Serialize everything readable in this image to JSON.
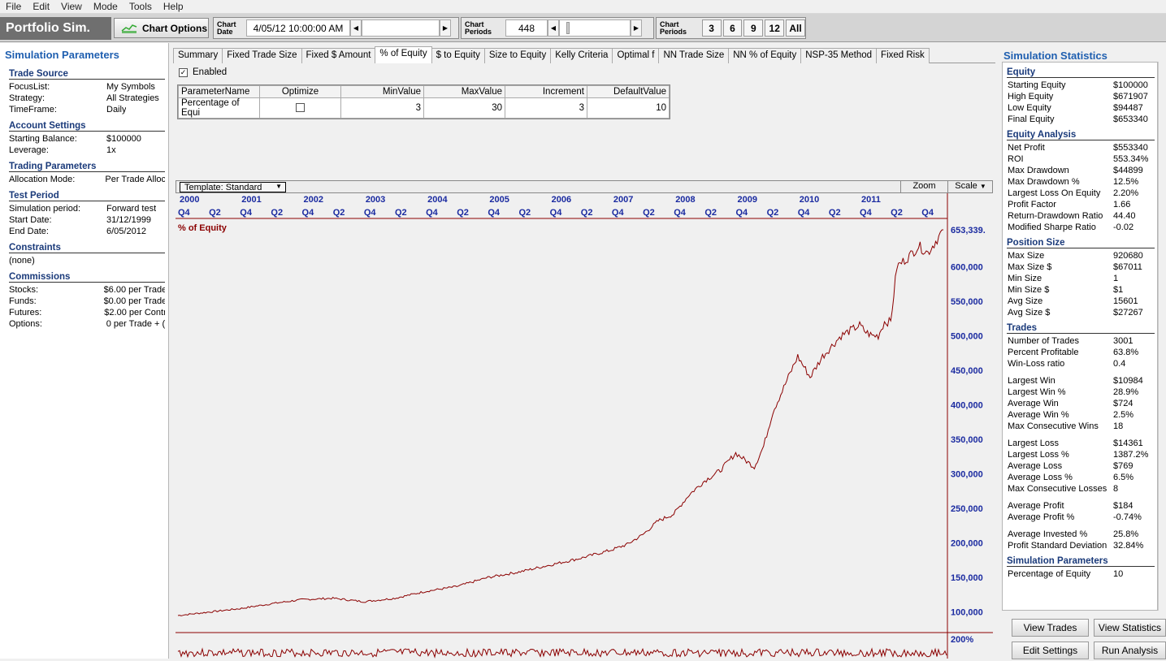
{
  "menu": [
    "File",
    "Edit",
    "View",
    "Mode",
    "Tools",
    "Help"
  ],
  "toolbar": {
    "app_name": "Portfolio Sim.",
    "chart_options_label": "Chart Options",
    "chart_date_label_1": "Chart",
    "chart_date_label_2": "Date",
    "chart_date_value": "4/05/12 10:00:00 AM",
    "chart_periods_label_1": "Chart",
    "chart_periods_label_2": "Periods",
    "chart_periods_value": "448",
    "periods_label_1": "Chart",
    "periods_label_2": "Periods",
    "period_buttons": [
      "3",
      "6",
      "9",
      "12",
      "All"
    ]
  },
  "left": {
    "title": "Simulation Parameters",
    "trade_source": {
      "heading": "Trade Source",
      "rows": [
        [
          "FocusList:",
          "My Symbols"
        ],
        [
          "Strategy:",
          "All Strategies"
        ],
        [
          "TimeFrame:",
          "Daily"
        ]
      ]
    },
    "account": {
      "heading": "Account Settings",
      "rows": [
        [
          "Starting Balance:",
          "$100000"
        ],
        [
          "Leverage:",
          "1x"
        ]
      ]
    },
    "trading": {
      "heading": "Trading Parameters",
      "rows": [
        [
          "Allocation Mode:",
          "Per Trade Alloc"
        ]
      ]
    },
    "test_period": {
      "heading": "Test Period",
      "rows": [
        [
          "Simulation period:",
          "Forward test"
        ],
        [
          "Start Date:",
          "31/12/1999"
        ],
        [
          "End Date:",
          "6/05/2012"
        ]
      ]
    },
    "constraints": {
      "heading": "Constraints",
      "value": "(none)"
    },
    "commissions": {
      "heading": "Commissions",
      "rows": [
        [
          "Stocks:",
          "$6.00 per Trade"
        ],
        [
          "Funds:",
          "$0.00 per Trade"
        ],
        [
          "Futures:",
          "$2.00 per Contr"
        ],
        [
          "Options:",
          "0 per Trade  + ("
        ]
      ]
    }
  },
  "tabs": [
    "Summary",
    "Fixed Trade Size",
    "Fixed $ Amount",
    "% of Equity",
    "$ to Equity",
    "Size to Equity",
    "Kelly Criteria",
    "Optimal f",
    "NN Trade Size",
    "NN % of Equity",
    "NSP-35 Method",
    "Fixed Risk"
  ],
  "enabled_label": "Enabled",
  "param_grid": {
    "headers": [
      "ParameterName",
      "Optimize",
      "MinValue",
      "MaxValue",
      "Increment",
      "DefaultValue"
    ],
    "row": {
      "name": "Percentage of Equi",
      "min": "3",
      "max": "30",
      "inc": "3",
      "def": "10"
    }
  },
  "chart_toolbar": {
    "template": "Template: Standard",
    "zoom": "Zoom",
    "scale": "Scale"
  },
  "chart_data": {
    "type": "line",
    "title": "% of Equity",
    "last_value_label": "653,339.",
    "years": [
      "2000",
      "2001",
      "2002",
      "2003",
      "2004",
      "2005",
      "2006",
      "2007",
      "2008",
      "2009",
      "2010",
      "2011"
    ],
    "quarters": [
      "Q4",
      "Q2",
      "Q4",
      "Q2",
      "Q4",
      "Q2",
      "Q4",
      "Q2",
      "Q4",
      "Q2",
      "Q4",
      "Q2",
      "Q4",
      "Q2",
      "Q4",
      "Q2",
      "Q4",
      "Q2",
      "Q4",
      "Q2",
      "Q4",
      "Q2",
      "Q4",
      "Q2",
      "Q4"
    ],
    "y_ticks": [
      "600,000",
      "550,000",
      "500,000",
      "450,000",
      "400,000",
      "350,000",
      "300,000",
      "250,000",
      "200,000",
      "150,000",
      "100,000"
    ],
    "ylim": [
      75000,
      665000
    ],
    "x": [
      2000.0,
      2000.5,
      2001.0,
      2001.5,
      2002.0,
      2002.5,
      2003.0,
      2003.5,
      2004.0,
      2004.5,
      2005.0,
      2005.5,
      2006.0,
      2006.5,
      2007.0,
      2007.25,
      2007.5,
      2007.75,
      2008.0,
      2008.25,
      2008.5,
      2008.75,
      2009.0,
      2009.15,
      2009.3,
      2009.45,
      2009.6,
      2009.75,
      2009.9,
      2010.0,
      2010.2,
      2010.4,
      2010.5,
      2010.7,
      2010.9,
      2011.0,
      2011.1,
      2011.2,
      2011.3,
      2011.4,
      2011.5,
      2011.6,
      2011.8,
      2011.95,
      2012.1,
      2012.35
    ],
    "y": [
      95000,
      100000,
      105000,
      112000,
      118000,
      120000,
      115000,
      120000,
      130000,
      137000,
      150000,
      158000,
      168000,
      178000,
      190000,
      198000,
      212000,
      232000,
      242000,
      270000,
      290000,
      305000,
      330000,
      320000,
      310000,
      340000,
      390000,
      420000,
      450000,
      470000,
      440000,
      470000,
      480000,
      500000,
      510000,
      515000,
      505000,
      500000,
      500000,
      520000,
      520000,
      600000,
      615000,
      630000,
      620000,
      653339
    ],
    "sub_label": "200%"
  },
  "right": {
    "title": "Simulation Statistics",
    "sections": [
      {
        "heading": "Equity",
        "rows": [
          [
            "Starting Equity",
            "$100000"
          ],
          [
            "High Equity",
            "$671907"
          ],
          [
            "Low Equity",
            "$94487"
          ],
          [
            "Final Equity",
            "$653340"
          ]
        ]
      },
      {
        "heading": "Equity Analysis",
        "rows": [
          [
            "Net Profit",
            "$553340"
          ],
          [
            "ROI",
            "553.34%"
          ],
          [
            "Max Drawdown",
            "$44899"
          ],
          [
            "Max Drawdown %",
            "12.5%"
          ],
          [
            "Largest Loss On Equity",
            "2.20%"
          ],
          [
            "Profit Factor",
            "1.66"
          ],
          [
            "Return-Drawdown Ratio",
            "44.40"
          ],
          [
            "Modified Sharpe Ratio",
            "-0.02"
          ]
        ]
      },
      {
        "heading": "Position Size",
        "rows": [
          [
            "Max Size",
            "920680"
          ],
          [
            "Max Size $",
            "$67011"
          ],
          [
            "Min Size",
            "1"
          ],
          [
            "Min Size $",
            "$1"
          ],
          [
            "Avg Size",
            "15601"
          ],
          [
            "Avg Size $",
            "$27267"
          ]
        ]
      },
      {
        "heading": "Trades",
        "rows": [
          [
            "Number of Trades",
            "3001"
          ],
          [
            "Percent Profitable",
            "63.8%"
          ],
          [
            "Win-Loss ratio",
            "0.4"
          ],
          [
            "",
            ""
          ],
          [
            "Largest Win",
            "$10984"
          ],
          [
            "Largest Win %",
            "28.9%"
          ],
          [
            "Average Win",
            "$724"
          ],
          [
            "Average Win %",
            "2.5%"
          ],
          [
            "Max Consecutive Wins",
            "18"
          ],
          [
            "",
            ""
          ],
          [
            "Largest Loss",
            "$14361"
          ],
          [
            "Largest Loss %",
            "1387.2%"
          ],
          [
            "Average Loss",
            "$769"
          ],
          [
            "Average Loss %",
            "6.5%"
          ],
          [
            "Max Consecutive Losses",
            "8"
          ],
          [
            "",
            ""
          ],
          [
            "Average Profit",
            "$184"
          ],
          [
            "Average Profit %",
            "-0.74%"
          ],
          [
            "",
            ""
          ],
          [
            "Average Invested %",
            "25.8%"
          ],
          [
            "Profit Standard Deviation",
            "32.84%"
          ]
        ]
      },
      {
        "heading": "Simulation Parameters",
        "rows": [
          [
            "Percentage of Equity",
            "10"
          ]
        ]
      }
    ],
    "buttons": {
      "view_trades": "View Trades",
      "view_statistics": "View Statistics",
      "edit_settings": "Edit Settings",
      "run_analysis": "Run Analysis"
    }
  }
}
